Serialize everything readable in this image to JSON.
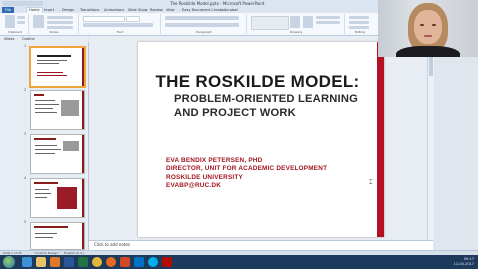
{
  "window": {
    "title": "The Roskilde Model.pptx - Microsoft PowerPoint"
  },
  "ribbon_tabs": [
    "File",
    "Home",
    "Insert",
    "Design",
    "Transitions",
    "Animations",
    "Slide Show",
    "Review",
    "View",
    "Easy Document Creator",
    "Acrobat"
  ],
  "active_tab": "Home",
  "ribbon_groups": [
    "Clipboard",
    "Slides",
    "Font",
    "Paragraph",
    "Drawing",
    "Editing"
  ],
  "pane_tabs": [
    "Slides",
    "Outline"
  ],
  "thumbnails": [
    {
      "num": "1",
      "title": "THE ROSKILDE MODEL:",
      "selected": true
    },
    {
      "num": "2",
      "title": "AGENDA",
      "selected": false
    },
    {
      "num": "3",
      "title": "ONCE UPON A TIME...",
      "selected": false
    },
    {
      "num": "4",
      "title": "\"THE ROSKILDE MODEL\"",
      "selected": false
    },
    {
      "num": "5",
      "title": "PEDAGOGICAL PRINCIPLES OF PPL",
      "selected": false
    }
  ],
  "slide": {
    "title": "THE ROSKILDE MODEL:",
    "subtitle_line1": "PROBLEM-ORIENTED LEARNING",
    "subtitle_line2": "AND PROJECT WORK",
    "author_lines": [
      "EVA BENDIX PETERSEN, PHD",
      "DIRECTOR, UNIT FOR ACADEMIC DEVELOPMENT",
      "ROSKILDE UNIVERSITY",
      "EVABP@RUC.DK"
    ],
    "accent_color": "#b50f22"
  },
  "notes": {
    "placeholder": "Click to add notes"
  },
  "status": {
    "slide_info": "Slide 1 of 25",
    "theme": "\"Custom Design\"",
    "language": "English (U.S.)"
  },
  "tray": {
    "time": "09:17",
    "date": "11-04-2017"
  },
  "taskbar_icons": [
    "ie-icon",
    "explorer-icon",
    "media-icon",
    "word-icon",
    "excel-icon",
    "chrome-icon",
    "firefox-icon",
    "powerpoint-icon",
    "outlook-icon",
    "skype-icon",
    "acrobat-icon"
  ]
}
